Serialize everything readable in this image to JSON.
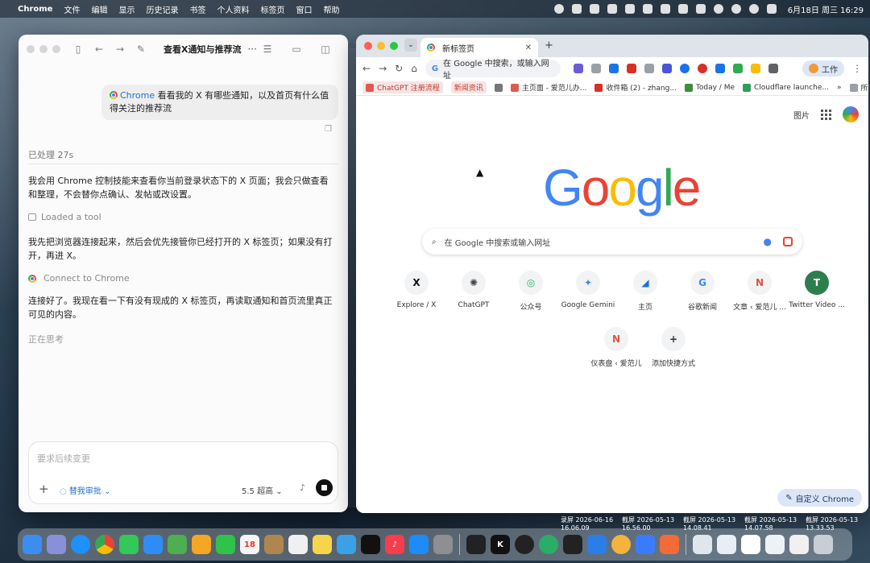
{
  "menubar": {
    "app": "Chrome",
    "items": [
      "文件",
      "编辑",
      "显示",
      "历史记录",
      "书签",
      "个人资料",
      "标签页",
      "窗口",
      "帮助"
    ],
    "clock": "6月18日 周三 16:29"
  },
  "panel": {
    "title": "查看X通知与推荐流",
    "more": "···",
    "user_message_mention": "Chrome",
    "user_message": "看看我的 X 有哪些通知，以及首页有什么值得关注的推荐流",
    "processed": "已处理 27s",
    "para1": "我会用 Chrome 控制技能来查看你当前登录状态下的 X 页面；我会只做查看和整理，不会替你点确认、发帖或改设置。",
    "tool1": "Loaded a tool",
    "para2": "我先把浏览器连接起来，然后会优先接管你已经打开的 X 标签页；如果没有打开，再进 X。",
    "tool2": "Connect to Chrome",
    "para3": "连接好了。我现在看一下有没有现成的 X 标签页，再读取通知和首页流里真正可见的内容。",
    "thinking": "正在思考",
    "composer": {
      "placeholder": "要求后续变更",
      "approval": "替我审批",
      "model": "5.5 超高"
    }
  },
  "chrome": {
    "tab_title": "新标签页",
    "omnibox_text": "在 Google 中搜索，或输入网址",
    "profile": "工作",
    "bookmarks": [
      {
        "label": "ChatGPT 注册流程",
        "color": "#e05a4f",
        "boxed": true
      },
      {
        "label": "新闻资讯",
        "color": "#e05a4f",
        "boxed": true
      },
      {
        "label": "",
        "color": "#777777",
        "boxed": false
      },
      {
        "label": "主页面 - 爱范儿办...",
        "color": "#e05a4f",
        "boxed": false
      },
      {
        "label": "收件箱 (2) - zhang...",
        "color": "#d93025",
        "boxed": false
      },
      {
        "label": "Today / Me",
        "color": "#3c8d3c",
        "boxed": false
      },
      {
        "label": "Cloudflare launche...",
        "color": "#2e9e5b",
        "boxed": false
      }
    ],
    "bookmarks_more": "»",
    "all_bookmarks": "所有书签",
    "top_links": {
      "images": "图片"
    },
    "google_letters": [
      "G",
      "o",
      "o",
      "g",
      "l",
      "e"
    ],
    "search_placeholder": "在 Google 中搜索或输入网址",
    "shortcuts": [
      {
        "label": "Explore / X",
        "glyph": "X",
        "color": "#111111"
      },
      {
        "label": "ChatGPT",
        "glyph": "✺",
        "color": "#444444"
      },
      {
        "label": "公众号",
        "glyph": "◎",
        "color": "#2aae67"
      },
      {
        "label": "Google Gemini",
        "glyph": "✦",
        "color": "#4285f4"
      },
      {
        "label": "主页",
        "glyph": "◢",
        "color": "#1e6fd9"
      },
      {
        "label": "谷歌新闻",
        "glyph": "G",
        "color": "#4285f4"
      },
      {
        "label": "文章 ‹ 爱范儿 ...",
        "glyph": "N",
        "color": "#e0533f"
      },
      {
        "label": "Twitter Video ...",
        "glyph": "T",
        "color": "#ffffff"
      },
      {
        "label": "仪表盘 ‹ 爱范儿",
        "glyph": "N",
        "color": "#e0533f"
      },
      {
        "label": "添加快捷方式",
        "glyph": "+",
        "color": "#333333"
      }
    ],
    "customize": "自定义 Chrome"
  },
  "desktop_shots": [
    [
      "录屏 2026-06-16",
      "16.06.09"
    ],
    [
      "截屏 2026-05-13",
      "16.56.00"
    ],
    [
      "截屏 2026-05-13",
      "14.08.41"
    ],
    [
      "截屏 2026-05-13",
      "14.07.58"
    ],
    [
      "截屏 2026-05-13",
      "13.33.53"
    ]
  ]
}
